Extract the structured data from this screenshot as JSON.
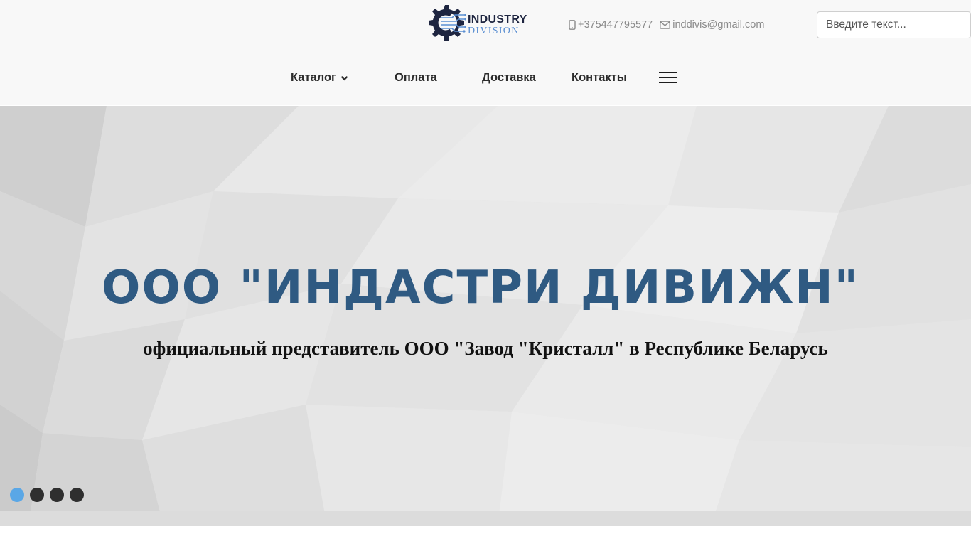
{
  "header": {
    "logo": {
      "line1": "INDUSTRY",
      "line2": "DIVISION"
    },
    "contacts": {
      "phone": "+375447795577",
      "email": "inddivis@gmail.com",
      "phone_icon": "mobile-phone-icon",
      "email_icon": "envelope-icon"
    },
    "search": {
      "placeholder": "Введите текст..."
    }
  },
  "nav": {
    "items": [
      {
        "label": "Каталог",
        "has_dropdown": true,
        "icon": "chevron-down-icon"
      },
      {
        "label": "Оплата"
      },
      {
        "label": "Доставка"
      },
      {
        "label": "Контакты"
      }
    ],
    "menu_icon": "hamburger-menu-icon"
  },
  "hero": {
    "title": "ООО \"ИНДАСТРИ ДИВИЖН\"",
    "subtitle": "официальный представитель ООО \"Завод \"Кристалл\" в Республике Беларусь",
    "slides_count": 4,
    "active_slide": 1
  },
  "colors": {
    "title": "#2f5a82",
    "active_dot": "#5aa7e6",
    "inactive_dot": "#2f2f2f",
    "header_bg": "#f8f8f8",
    "logo_dark": "#1e2540",
    "logo_blue": "#5b8fd2"
  }
}
